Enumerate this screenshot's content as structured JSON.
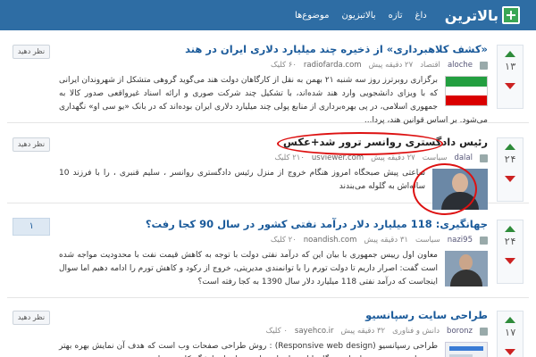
{
  "header": {
    "logo_text": "بالاترین",
    "nav": [
      "داغ",
      "تازه",
      "بالاتبزیون",
      "موضوع‌ها"
    ]
  },
  "posts": [
    {
      "votes": "۱۳",
      "title": "«کشف کلاهبرداری» از ذخیره چند میلیارد دلاری ایران در هند",
      "user": "aloche",
      "category": "اقتصاد",
      "time": "۲۷ دقیقه پیش",
      "site": "radiofarda.com",
      "clicks": "۶۰ کلیک",
      "comment_label": "نظر دهید",
      "down_count": "۱",
      "body": "برگزاری روبرترز روز سه شنبه ۲۱ بهمن به نقل از کارگاهان دولت هند می‌گوید گروهی متشکل از شهروندان ایرانی که با ویزای دانشجویی وارد هند شده‌اند، با تشکیل چند شرکت صوری و ارائه اسناد غیرواقعی صدور کالا به جمهوری اسلامی، در پی بهره‌برداری از منابع پولی چند میلیارد دلاری ایران بوده‌اند که در بانک «یو سی او» نگهداری می‌شود. بر اساس قوانین هند، پردا..."
    },
    {
      "votes": "۲۴",
      "title": "رئیس دادگستری روانسر ترور شد+عکس",
      "user": "dalal",
      "category": "سیاست",
      "time": "۲۷ دقیقه پیش",
      "site": "usviewer.com",
      "clicks": "۲۱۰ کلیک",
      "comment_label": "نظر دهید",
      "down_count": "۰",
      "body": "ساعتی پیش صبحگاه امروز هنگام خروج از منزل رئیس دادگستری روانسر ، سلیم قنبری ، را با فرزند 10 ساله‌اش به گلوله می‌بندند"
    },
    {
      "votes": "۲۴",
      "title": "جهانگیری: 118 میلیارد دلار درآمد نفتی کشور در سال 90 کجا رفت؟",
      "user": "nazi95",
      "category": "سیاست",
      "time": "۳۱ دقیقه پیش",
      "site": "noandish.com",
      "clicks": "۲۰ کلیک",
      "comment_count": "۱",
      "down_count": "۰",
      "body": "معاون اول رییس جمهوری با بیان این که درآمد نفتی دولت با توجه به کاهش قیمت نفت با محدودیت مواجه شده است گفت: اصرار داریم تا دولت تورم را با توانمندی مدیریتی، خروج از رکود و کاهش تورم را ادامه دهیم اما سوال اینجاست که درآمد نفتی 118 میلیارد دلار سال 1390 به کجا رفته است؟"
    },
    {
      "votes": "۱۷",
      "title": "طراحی سایت رسپانسیو",
      "user": "boronz",
      "category": "دانش و فناوری",
      "time": "۳۲ دقیقه پیش",
      "site": "sayehco.ir",
      "clicks": "۰ کلیک",
      "comment_label": "نظر دهید",
      "down_count": "۰",
      "body": "طراحی رسپانسیو (Responsive web design) : روش طراحی صفحات وب است که هدف آن نمایش بهره بهتر وب سایت در مجموعه ای از دستگاه‌ها از جمله تلفن‌های همراه تا نمایشگر کامپیوترهای"
    }
  ]
}
